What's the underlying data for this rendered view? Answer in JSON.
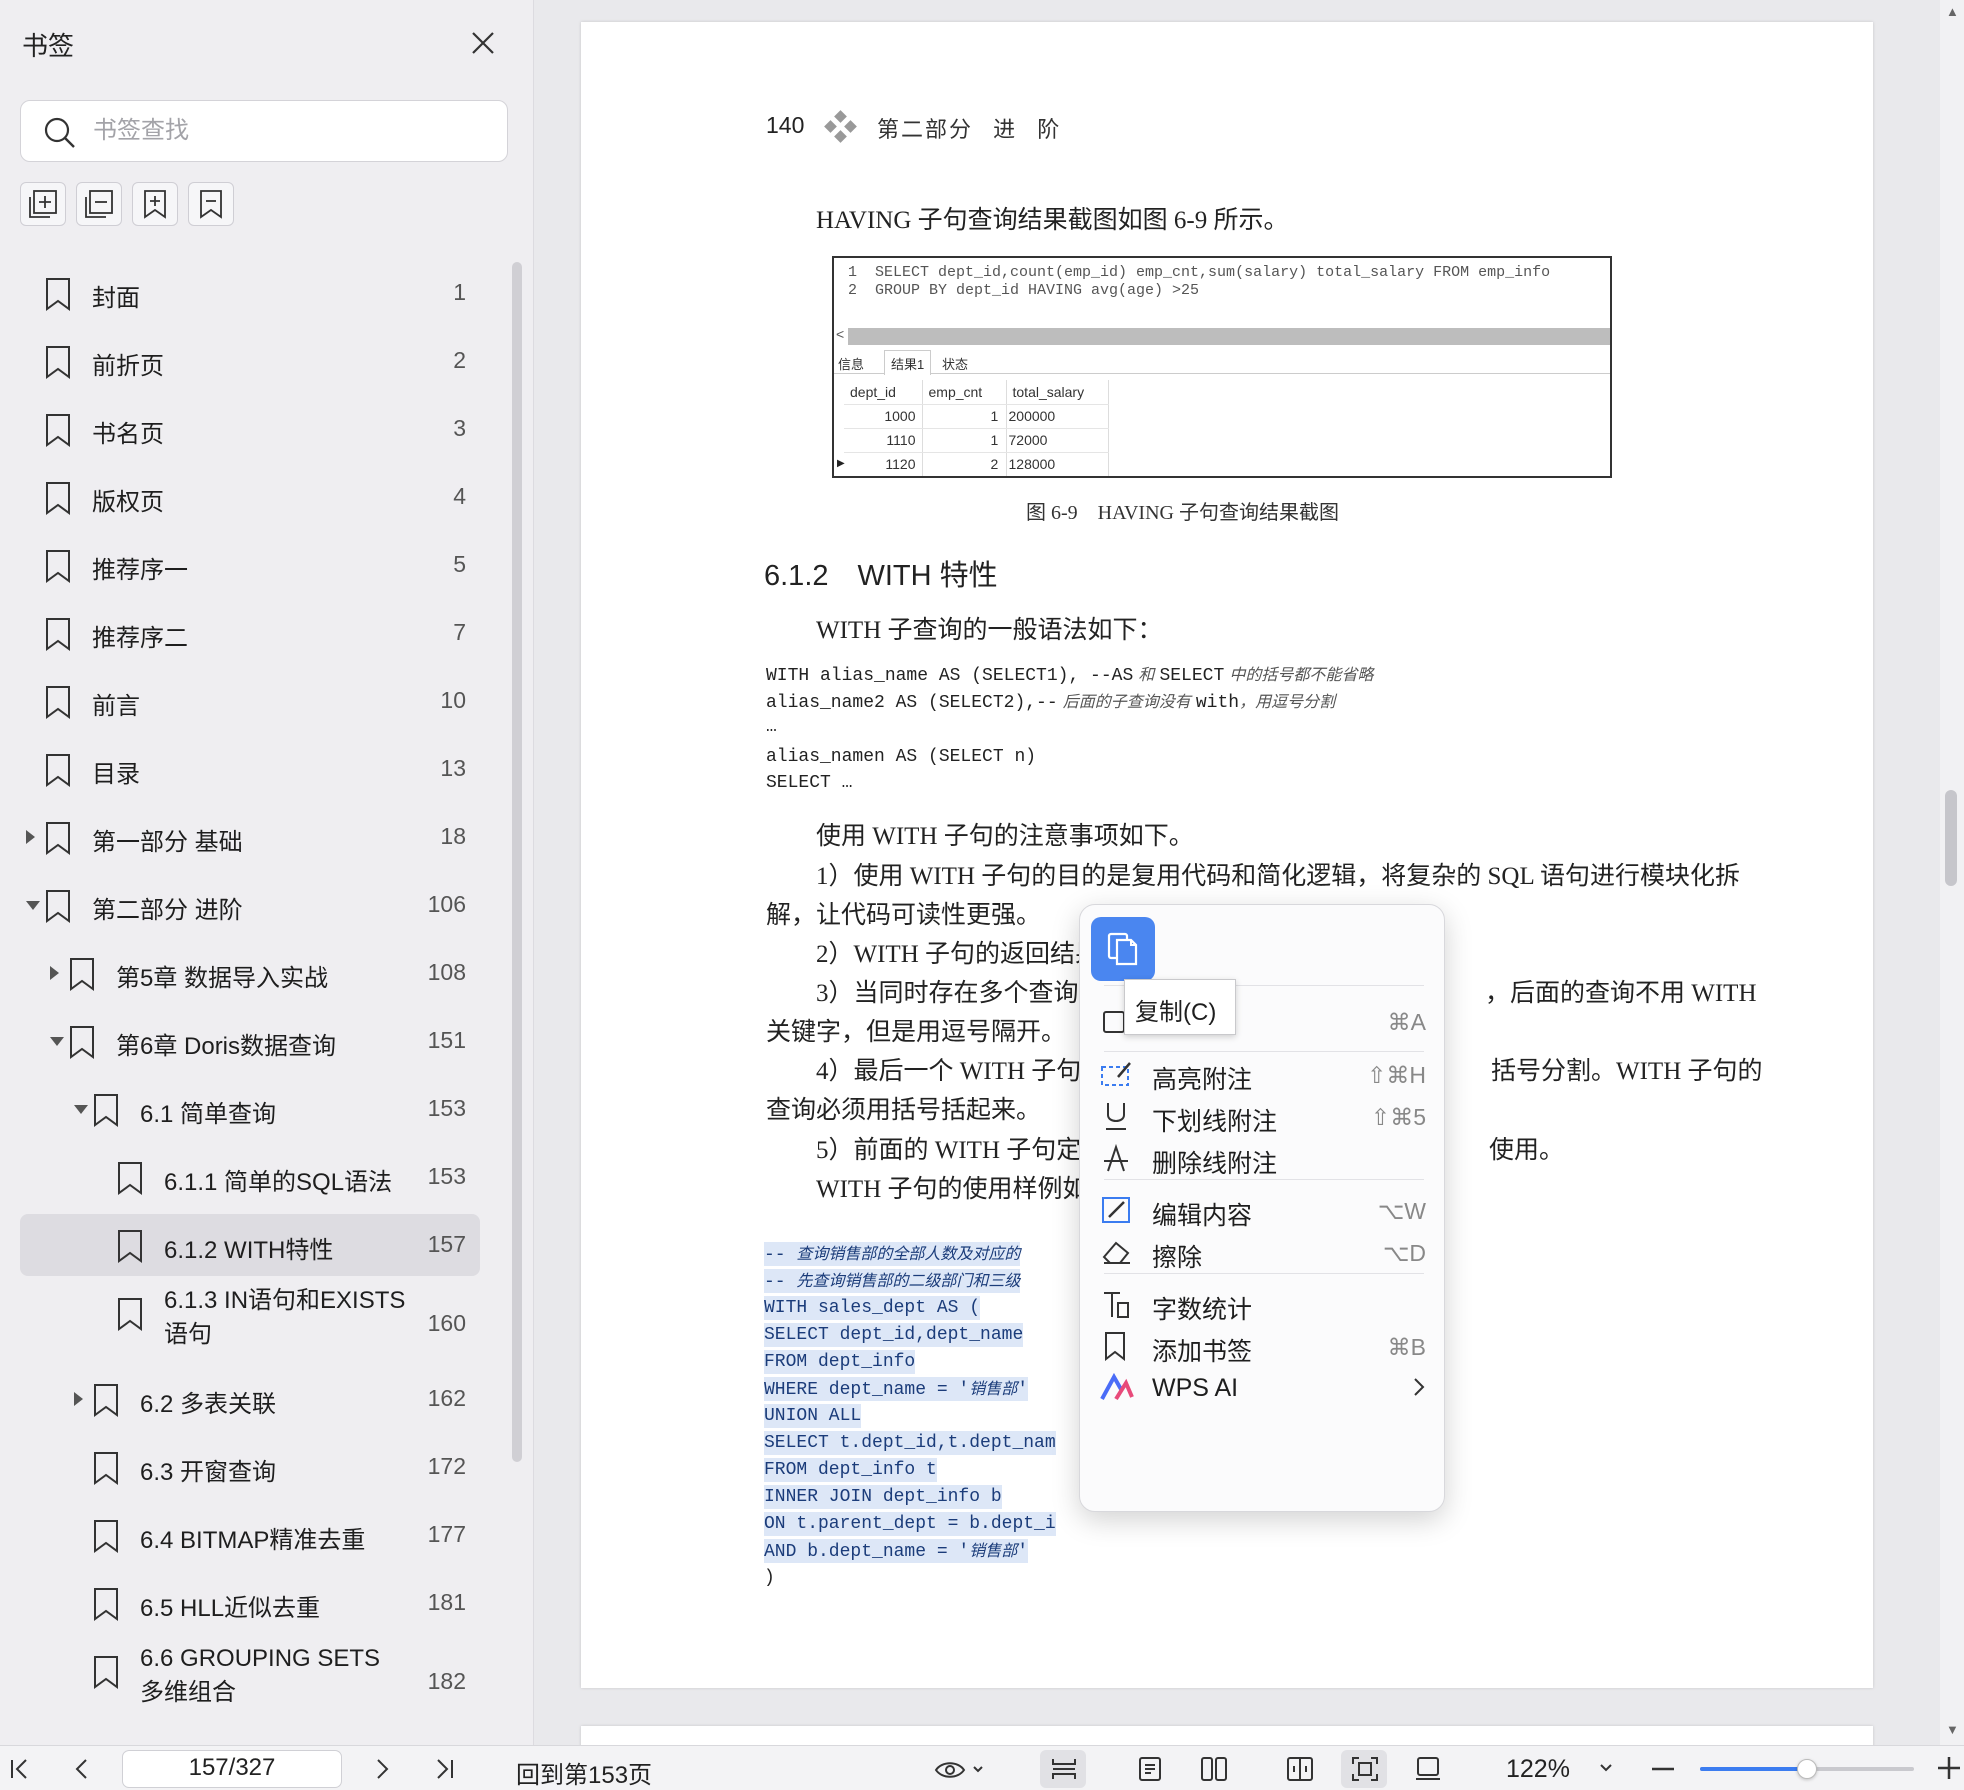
{
  "sidebar": {
    "title": "书签",
    "search_placeholder": "书签查找",
    "items": [
      {
        "label": "封面",
        "page": "1",
        "level": 0,
        "toggle": "none"
      },
      {
        "label": "前折页",
        "page": "2",
        "level": 0,
        "toggle": "none"
      },
      {
        "label": "书名页",
        "page": "3",
        "level": 0,
        "toggle": "none"
      },
      {
        "label": "版权页",
        "page": "4",
        "level": 0,
        "toggle": "none"
      },
      {
        "label": "推荐序一",
        "page": "5",
        "level": 0,
        "toggle": "none"
      },
      {
        "label": "推荐序二",
        "page": "7",
        "level": 0,
        "toggle": "none"
      },
      {
        "label": "前言",
        "page": "10",
        "level": 0,
        "toggle": "none"
      },
      {
        "label": "目录",
        "page": "13",
        "level": 0,
        "toggle": "none"
      },
      {
        "label": "第一部分 基础",
        "page": "18",
        "level": 0,
        "toggle": "collapsed"
      },
      {
        "label": "第二部分 进阶",
        "page": "106",
        "level": 0,
        "toggle": "expanded"
      },
      {
        "label": "第5章 数据导入实战",
        "page": "108",
        "level": 1,
        "toggle": "collapsed"
      },
      {
        "label": "第6章 Doris数据查询",
        "page": "151",
        "level": 1,
        "toggle": "expanded"
      },
      {
        "label": "6.1 简单查询",
        "page": "153",
        "level": 2,
        "toggle": "expanded"
      },
      {
        "label": "6.1.1 简单的SQL语法",
        "page": "153",
        "level": 3,
        "toggle": "none"
      },
      {
        "label": "6.1.2 WITH特性",
        "page": "157",
        "level": 3,
        "toggle": "none",
        "selected": true
      },
      {
        "label": "6.1.3 IN语句和EXISTS语句",
        "page": "160",
        "level": 3,
        "toggle": "none"
      },
      {
        "label": "6.2 多表关联",
        "page": "162",
        "level": 2,
        "toggle": "collapsed"
      },
      {
        "label": "6.3 开窗查询",
        "page": "172",
        "level": 2,
        "toggle": "none"
      },
      {
        "label": "6.4 BITMAP精准去重",
        "page": "177",
        "level": 2,
        "toggle": "none"
      },
      {
        "label": "6.5 HLL近似去重",
        "page": "181",
        "level": 2,
        "toggle": "none"
      },
      {
        "label": "6.6 GROUPING SETS多维组合",
        "page": "182",
        "level": 2,
        "toggle": "none"
      }
    ]
  },
  "doc": {
    "page_number": "140",
    "header": "第二部分 进 阶",
    "intro": "HAVING 子句查询结果截图如图 6-9 所示。",
    "figure": {
      "sql_line1": "1  SELECT dept_id,count(emp_id) emp_cnt,sum(salary) total_salary FROM emp_info",
      "sql_line2": "2  GROUP BY dept_id HAVING avg(age) >25",
      "tabs": [
        "信息",
        "结果1",
        "状态"
      ],
      "columns": [
        "dept_id",
        "emp_cnt",
        "total_salary"
      ],
      "rows": [
        [
          "1000",
          "1",
          "200000"
        ],
        [
          "1110",
          "1",
          "72000"
        ],
        [
          "1120",
          "2",
          "128000"
        ]
      ]
    },
    "caption": "图 6-9　HAVING 子句查询结果截图",
    "section_title": "6.1.2　WITH 特性",
    "p_syntax": "WITH 子查询的一般语法如下：",
    "code1": [
      {
        "code": "WITH alias_name AS (SELECT1), --AS",
        "comment": " 和 ",
        "code2": "SELECT",
        "comment2": " 中的括号都不能省略"
      },
      {
        "code": "alias_name2 AS (SELECT2),--",
        "comment": " 后面的子查询没有 ",
        "code2": "with",
        "comment2": "，用逗号分割"
      },
      {
        "code": "…",
        "comment": "",
        "code2": "",
        "comment2": ""
      },
      {
        "code": "alias_namen AS (SELECT n)",
        "comment": "",
        "code2": "",
        "comment2": ""
      },
      {
        "code": "SELECT …",
        "comment": "",
        "code2": "",
        "comment2": ""
      }
    ],
    "notes_title": "使用 WITH 子句的注意事项如下。",
    "note1a": "1）使用 WITH 子句的目的是复用代码和简化逻辑，将复杂的 SQL 语句进行模块化拆",
    "note1b": "解，让代码可读性更强。",
    "note2": "2）WITH 子句的返回结果存",
    "note3a_left": "3）当同时存在多个查询定义",
    "note3a_right": "，后面的查询不用 WITH",
    "note3b": "关键字，但是用逗号隔开。",
    "note4a_left": "4）最后一个 WITH 子句与主",
    "note4a_right": "括号分割。WITH 子句的",
    "note4b": "查询必须用括号括起来。",
    "note5_left": "5）前面的 WITH 子句定义的",
    "note5_right": "使用。",
    "example_title": "WITH 子句的使用样例如下：",
    "code2": [
      {
        "code": "-- ",
        "comment": "查询销售部的全部人数及对应的"
      },
      {
        "code": "-- ",
        "comment": "先查询销售部的二级部门和三级"
      },
      {
        "code": "WITH sales_dept AS (",
        "comment": ""
      },
      {
        "code": "SELECT dept_id,dept_name",
        "comment": ""
      },
      {
        "code": "FROM dept_info",
        "comment": ""
      },
      {
        "code": "WHERE dept_name = '",
        "comment": "销售部",
        "code2": "'"
      },
      {
        "code": "UNION ALL",
        "comment": ""
      },
      {
        "code": "SELECT t.dept_id,t.dept_nam",
        "comment": ""
      },
      {
        "code": "FROM dept_info t",
        "comment": ""
      },
      {
        "code": "INNER JOIN dept_info b",
        "comment": ""
      },
      {
        "code": "ON t.parent_dept = b.dept_i",
        "comment": ""
      },
      {
        "code": "AND b.dept_name = '",
        "comment": "销售部",
        "code2": "'"
      },
      {
        "code": ")",
        "comment": ""
      }
    ]
  },
  "context_menu": {
    "tooltip": "复制(C)",
    "select_all_shortcut": "⌘A",
    "items": [
      {
        "label": "高亮附注",
        "shortcut": "⇧⌘H",
        "icon": "highlight-icon"
      },
      {
        "label": "下划线附注",
        "shortcut": "⇧⌘5",
        "icon": "underline-icon"
      },
      {
        "label": "删除线附注",
        "shortcut": "",
        "icon": "strikethrough-icon"
      },
      {
        "label": "编辑内容",
        "shortcut": "⌥W",
        "icon": "edit-icon"
      },
      {
        "label": "擦除",
        "shortcut": "⌥D",
        "icon": "eraser-icon"
      },
      {
        "label": "字数统计",
        "shortcut": "",
        "icon": "word-count-icon"
      },
      {
        "label": "添加书签",
        "shortcut": "⌘B",
        "icon": "bookmark-icon"
      },
      {
        "label": "WPS AI",
        "shortcut": "",
        "icon": "wps-ai-icon"
      }
    ]
  },
  "bottombar": {
    "page_indicator": "157/327",
    "back_label": "回到第153页",
    "zoom": "122%",
    "zoom_slider_fraction": 0.5
  },
  "colors": {
    "accent": "#3b7cf0",
    "selection": "#dde7f7",
    "sidebar_bg": "#efeef1"
  }
}
